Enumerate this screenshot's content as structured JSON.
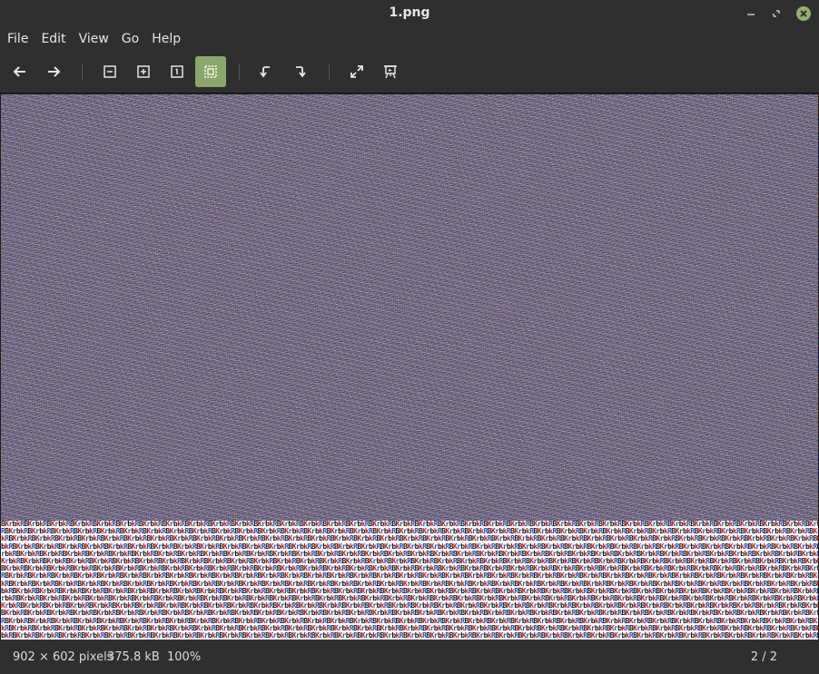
{
  "window": {
    "title": "1.png"
  },
  "menu": {
    "items": [
      {
        "label": "File"
      },
      {
        "label": "Edit"
      },
      {
        "label": "View"
      },
      {
        "label": "Go"
      },
      {
        "label": "Help"
      }
    ]
  },
  "toolbar": {
    "buttons": [
      {
        "icon": "arrow-left-icon"
      },
      {
        "icon": "arrow-right-icon"
      },
      {
        "icon": "zoom-out-icon"
      },
      {
        "icon": "zoom-in-icon"
      },
      {
        "icon": "zoom-normal-icon"
      },
      {
        "icon": "zoom-fit-icon",
        "active": true
      },
      {
        "icon": "rotate-left-icon"
      },
      {
        "icon": "rotate-right-icon"
      },
      {
        "icon": "fullscreen-icon"
      },
      {
        "icon": "slideshow-icon"
      }
    ],
    "active_color": "#8aa86a"
  },
  "image": {
    "text_pattern": "BKrbkRBKrbkRBKrbkR"
  },
  "status": {
    "dimensions": "902 × 602 pixels",
    "file_size": "375.8 kB",
    "zoom": "100%",
    "position": "2 / 2"
  },
  "colors": {
    "background": "#2f2f2f",
    "accent": "#8aa86a",
    "close_button": "#8fb36a"
  }
}
